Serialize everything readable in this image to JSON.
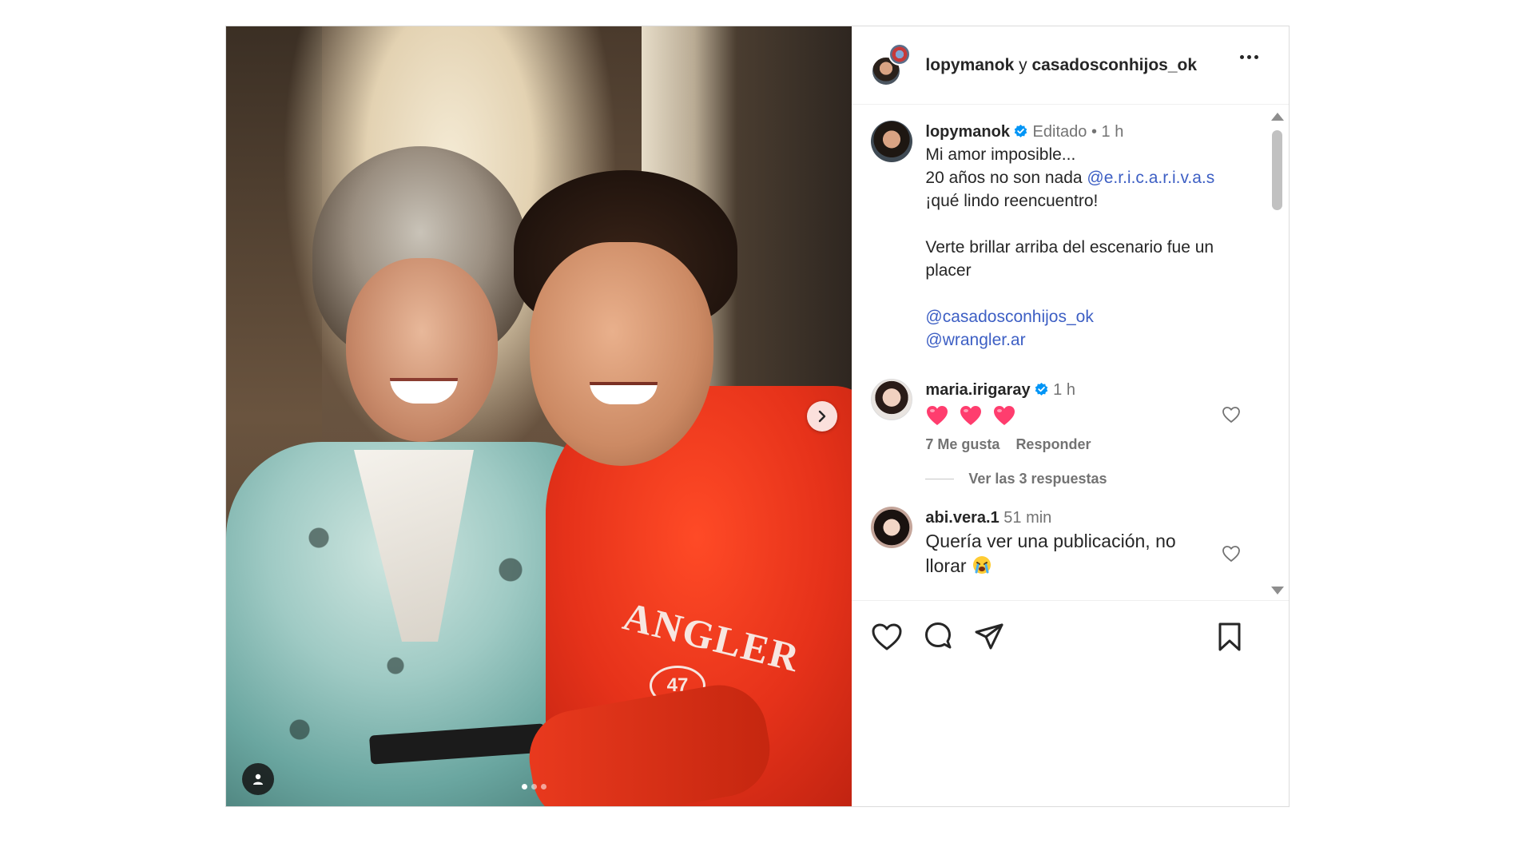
{
  "post": {
    "header": {
      "user1": "lopymanok",
      "connector": "y",
      "user2": "casadosconhijos_ok"
    },
    "caption": {
      "username": "lopymanok",
      "edited": "Editado",
      "separator": "•",
      "time": "1 h",
      "line1": "Mi amor imposible...",
      "line2_text": "20 años no son nada ",
      "line2_mention": "@e.r.i.c.a.r.i.v.a.s",
      "line3": "¡qué lindo reencuentro!",
      "line4": "Verte brillar arriba del escenario fue un",
      "line5": "placer",
      "mention1": "@casadosconhijos_ok",
      "mention2": "@wrangler.ar"
    },
    "comments": [
      {
        "username": "maria.irigaray",
        "time": "1 h",
        "body": "",
        "emoji": "heart-emoji x3",
        "likes": "7 Me gusta",
        "reply": "Responder",
        "view_replies": "Ver las 3 respuestas"
      },
      {
        "username": "abi.vera.1",
        "time": "51 min",
        "body_line1": "Quería ver una publicación, no",
        "body_line2": "llorar",
        "emoji": "crying-face"
      }
    ],
    "media": {
      "hoodie_text": "ANGLER",
      "hoodie_number": "47",
      "carousel_count": 3,
      "carousel_active": 1
    },
    "colors": {
      "link": "#3d5fc4",
      "verified": "#0095f6",
      "heart_emoji": "#ff3d6e"
    }
  }
}
